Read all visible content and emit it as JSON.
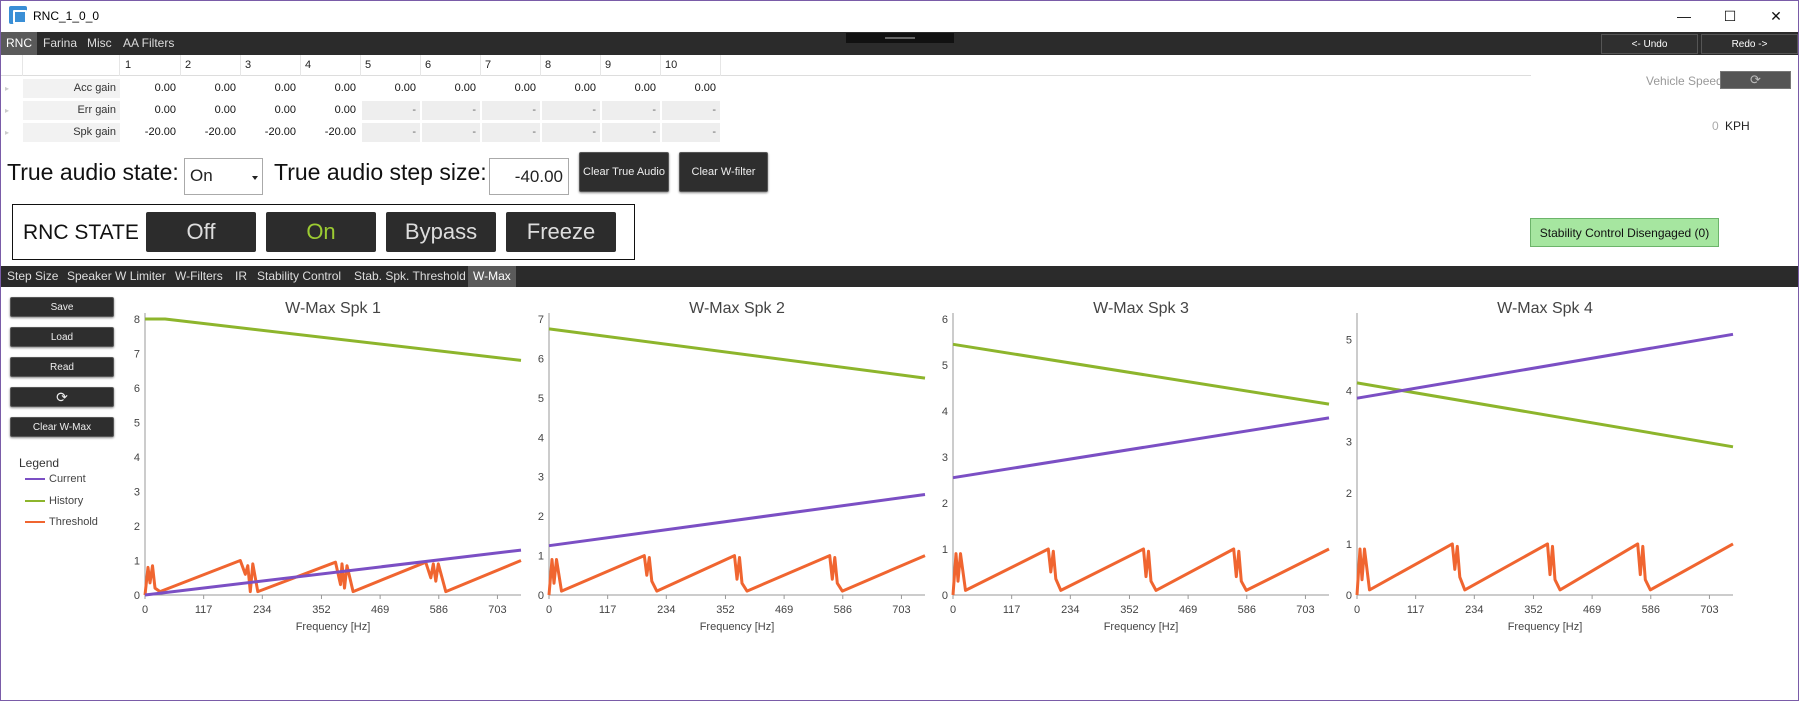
{
  "window": {
    "title": "RNC_1_0_0",
    "minimize": "—",
    "maximize": "☐",
    "close": "✕"
  },
  "menu_tabs": [
    {
      "label": "RNC",
      "active": true
    },
    {
      "label": "Farina",
      "active": false
    },
    {
      "label": "Misc",
      "active": false
    },
    {
      "label": "AA Filters",
      "active": false
    }
  ],
  "undo_label": "<- Undo",
  "redo_label": "Redo ->",
  "grid": {
    "columns": [
      "1",
      "2",
      "3",
      "4",
      "5",
      "6",
      "7",
      "8",
      "9",
      "10"
    ],
    "rows": [
      {
        "label": "Acc gain",
        "values": [
          "0.00",
          "0.00",
          "0.00",
          "0.00",
          "0.00",
          "0.00",
          "0.00",
          "0.00",
          "0.00",
          "0.00"
        ],
        "dim": [
          false,
          false,
          false,
          false,
          false,
          false,
          false,
          false,
          false,
          false
        ]
      },
      {
        "label": "Err gain",
        "values": [
          "0.00",
          "0.00",
          "0.00",
          "0.00",
          "-",
          "-",
          "-",
          "-",
          "-",
          "-"
        ],
        "dim": [
          false,
          false,
          false,
          false,
          true,
          true,
          true,
          true,
          true,
          true
        ]
      },
      {
        "label": "Spk gain",
        "values": [
          "-20.00",
          "-20.00",
          "-20.00",
          "-20.00",
          "-",
          "-",
          "-",
          "-",
          "-",
          "-"
        ],
        "dim": [
          false,
          false,
          false,
          false,
          true,
          true,
          true,
          true,
          true,
          true
        ]
      }
    ]
  },
  "true_audio": {
    "state_label": "True audio state:",
    "state_value": "On",
    "step_label": "True audio step size:",
    "step_value": "-40.00",
    "clear_true_audio": "Clear True Audio",
    "clear_w_filter": "Clear W-filter"
  },
  "rnc_state": {
    "label": "RNC STATE",
    "buttons": [
      "Off",
      "On",
      "Bypass",
      "Freeze"
    ],
    "active": "On"
  },
  "vehicle": {
    "label": "Vehicle Speed",
    "refresh_icon": "refresh-icon",
    "value": "0",
    "unit": "KPH"
  },
  "stability": "Stability Control Disengaged (0)",
  "sub_tabs": [
    {
      "label": "Step Size",
      "active": false
    },
    {
      "label": "Speaker W Limiter",
      "active": false
    },
    {
      "label": "W-Filters",
      "active": false
    },
    {
      "label": "IR",
      "active": false
    },
    {
      "label": "Stability Control",
      "active": false
    },
    {
      "label": "Stab. Spk. Threshold",
      "active": false
    },
    {
      "label": "W-Max",
      "active": true
    }
  ],
  "side_buttons": {
    "save": "Save",
    "load": "Load",
    "read": "Read",
    "clear": "Clear W-Max"
  },
  "legend": {
    "title": "Legend",
    "items": [
      {
        "label": "Current",
        "color": "#7b4fc4"
      },
      {
        "label": "History",
        "color": "#8db52c"
      },
      {
        "label": "Threshold",
        "color": "#f06530"
      }
    ]
  },
  "chart_data": [
    {
      "type": "line",
      "title": "W-Max Spk 1",
      "xlabel": "Frequency [Hz]",
      "ylabel": "",
      "xticks": [
        0,
        117,
        234,
        352,
        469,
        586,
        703
      ],
      "xlim": [
        0,
        750
      ],
      "yticks": [
        0,
        1,
        2,
        3,
        4,
        5,
        6,
        7,
        8
      ],
      "ylim": [
        0,
        8
      ],
      "series": [
        {
          "name": "Current",
          "x": [
            0,
            750
          ],
          "y": [
            0,
            1.3
          ]
        },
        {
          "name": "History",
          "x": [
            0,
            40,
            750
          ],
          "y": [
            8,
            8,
            6.8
          ]
        },
        {
          "name": "Threshold",
          "x": [
            0,
            6,
            10,
            15,
            20,
            30,
            190,
            200,
            205,
            210,
            215,
            225,
            380,
            390,
            393,
            398,
            403,
            415,
            560,
            570,
            575,
            580,
            585,
            600,
            750
          ],
          "y": [
            0,
            0.8,
            0.35,
            0.85,
            0.2,
            0.1,
            1.0,
            0.6,
            0.85,
            0.1,
            0.9,
            0.1,
            0.95,
            0.3,
            0.9,
            0.2,
            0.85,
            0.1,
            0.95,
            0.5,
            0.9,
            0.4,
            0.9,
            0.1,
            1.0
          ]
        }
      ]
    },
    {
      "type": "line",
      "title": "W-Max Spk 2",
      "xlabel": "Frequency [Hz]",
      "ylabel": "",
      "xticks": [
        0,
        117,
        234,
        352,
        469,
        586,
        703
      ],
      "xlim": [
        0,
        750
      ],
      "yticks": [
        0,
        1,
        2,
        3,
        4,
        5,
        6,
        7
      ],
      "ylim": [
        0,
        7
      ],
      "series": [
        {
          "name": "Current",
          "x": [
            0,
            750
          ],
          "y": [
            1.25,
            2.55
          ]
        },
        {
          "name": "History",
          "x": [
            0,
            750
          ],
          "y": [
            6.75,
            5.5
          ]
        },
        {
          "name": "Threshold",
          "x": [
            0,
            6,
            10,
            15,
            25,
            190,
            195,
            200,
            205,
            215,
            370,
            375,
            380,
            385,
            395,
            560,
            565,
            570,
            575,
            585,
            750
          ],
          "y": [
            0,
            0.9,
            0.3,
            0.9,
            0.1,
            1.0,
            0.5,
            0.95,
            0.35,
            0.1,
            1.0,
            0.4,
            0.95,
            0.3,
            0.1,
            1.0,
            0.4,
            0.95,
            0.3,
            0.1,
            1.0
          ]
        }
      ]
    },
    {
      "type": "line",
      "title": "W-Max Spk 3",
      "xlabel": "Frequency [Hz]",
      "ylabel": "",
      "xticks": [
        0,
        117,
        234,
        352,
        469,
        586,
        703
      ],
      "xlim": [
        0,
        750
      ],
      "yticks": [
        0,
        1,
        2,
        3,
        4,
        5,
        6
      ],
      "ylim": [
        0,
        6
      ],
      "series": [
        {
          "name": "Current",
          "x": [
            0,
            750
          ],
          "y": [
            2.55,
            3.85
          ]
        },
        {
          "name": "History",
          "x": [
            0,
            750
          ],
          "y": [
            5.45,
            4.15
          ]
        },
        {
          "name": "Threshold",
          "x": [
            0,
            6,
            10,
            15,
            25,
            190,
            195,
            200,
            205,
            215,
            380,
            385,
            390,
            395,
            405,
            560,
            565,
            570,
            575,
            585,
            750
          ],
          "y": [
            0,
            0.9,
            0.3,
            0.9,
            0.1,
            1.0,
            0.5,
            0.95,
            0.35,
            0.1,
            1.0,
            0.4,
            0.95,
            0.3,
            0.1,
            1.0,
            0.4,
            0.95,
            0.3,
            0.1,
            1.0
          ]
        }
      ]
    },
    {
      "type": "line",
      "title": "W-Max Spk 4",
      "xlabel": "Frequency [Hz]",
      "ylabel": "",
      "xticks": [
        0,
        117,
        234,
        352,
        469,
        586,
        703
      ],
      "xlim": [
        0,
        750
      ],
      "yticks": [
        0,
        1,
        2,
        3,
        4,
        5
      ],
      "ylim": [
        0,
        5.4
      ],
      "series": [
        {
          "name": "Current",
          "x": [
            0,
            750
          ],
          "y": [
            3.85,
            5.1
          ]
        },
        {
          "name": "History",
          "x": [
            0,
            750
          ],
          "y": [
            4.15,
            2.9
          ]
        },
        {
          "name": "Threshold",
          "x": [
            0,
            6,
            10,
            15,
            25,
            190,
            195,
            200,
            205,
            215,
            380,
            385,
            390,
            395,
            405,
            560,
            565,
            570,
            575,
            585,
            750
          ],
          "y": [
            0,
            0.9,
            0.3,
            0.9,
            0.1,
            1.0,
            0.5,
            0.95,
            0.35,
            0.1,
            1.0,
            0.4,
            0.95,
            0.3,
            0.1,
            1.0,
            0.4,
            0.95,
            0.3,
            0.1,
            1.0
          ]
        }
      ]
    }
  ]
}
